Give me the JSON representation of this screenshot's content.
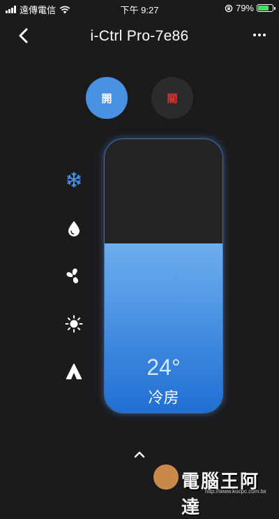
{
  "status_bar": {
    "carrier": "遠傳電信",
    "time": "下午 9:27",
    "battery_percent": "79%",
    "battery_level": 0.79,
    "icons": [
      "signal-icon",
      "wifi-icon",
      "rotation-lock-icon",
      "battery-icon"
    ]
  },
  "nav": {
    "title": "i-Ctrl Pro-7e86",
    "icons": [
      "back-chevron-icon",
      "more-dots-icon"
    ]
  },
  "power": {
    "on_label": "開",
    "off_label": "關"
  },
  "modes": [
    {
      "name": "cool",
      "icon": "snowflake-icon",
      "active": true
    },
    {
      "name": "dry",
      "icon": "water-drop-icon",
      "active": false
    },
    {
      "name": "fan",
      "icon": "fan-icon",
      "active": false
    },
    {
      "name": "heat",
      "icon": "sun-icon",
      "active": false
    },
    {
      "name": "auto",
      "icon": "letter-a-icon",
      "active": false
    }
  ],
  "thermostat": {
    "temperature": "24°",
    "mode_label": "冷房",
    "fill_level": 0.62
  },
  "colors": {
    "background": "#1b1b1d",
    "accent": "#4a90e2",
    "off_text": "#e0352b",
    "panel_fill_top": "#6daeee",
    "panel_fill_bottom": "#1f6fd3"
  },
  "watermark": {
    "text": "電腦王阿達",
    "url": "http://www.kocpc.com.tw"
  }
}
